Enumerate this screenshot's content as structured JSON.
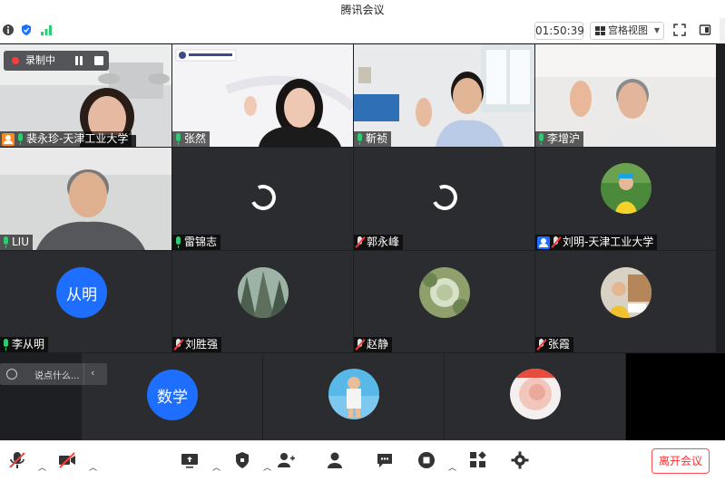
{
  "window": {
    "title": "腾讯会议"
  },
  "toolbar": {
    "timer": "01:50:39",
    "view_label": "宫格视图"
  },
  "recording": {
    "label": "录制中"
  },
  "participants": [
    {
      "name": "裴永珍-天津工业大学",
      "mic": "on",
      "badge": "orange-host",
      "type": "video"
    },
    {
      "name": "张然",
      "mic": "on",
      "type": "video"
    },
    {
      "name": "靳祯",
      "mic": "on",
      "type": "video"
    },
    {
      "name": "李增沪",
      "mic": "on",
      "type": "video"
    },
    {
      "name": "LIU",
      "mic": "on",
      "type": "video"
    },
    {
      "name": "雷锦志",
      "mic": "on",
      "type": "loading"
    },
    {
      "name": "郭永峰",
      "mic": "off",
      "type": "loading"
    },
    {
      "name": "刘明-天津工业大学",
      "mic": "off",
      "badge": "host",
      "type": "avatar"
    },
    {
      "name": "李从明",
      "mic": "on",
      "type": "text-avatar",
      "avatar_text": "从明"
    },
    {
      "name": "刘胜强",
      "mic": "off",
      "type": "avatar"
    },
    {
      "name": "赵静",
      "mic": "off",
      "type": "avatar"
    },
    {
      "name": "张霞",
      "mic": "off",
      "type": "avatar"
    },
    {
      "name": "",
      "type": "text-avatar",
      "avatar_text": "数学"
    },
    {
      "name": "",
      "type": "avatar"
    },
    {
      "name": "",
      "type": "avatar"
    }
  ],
  "chat": {
    "placeholder": "说点什么..."
  },
  "bottom": {
    "leave_label": "离开会议"
  },
  "colors": {
    "accent": "#1e6fff",
    "recording": "#ff3b3b",
    "mic_on": "#2ecc71",
    "leave": "#ff2d2d"
  }
}
